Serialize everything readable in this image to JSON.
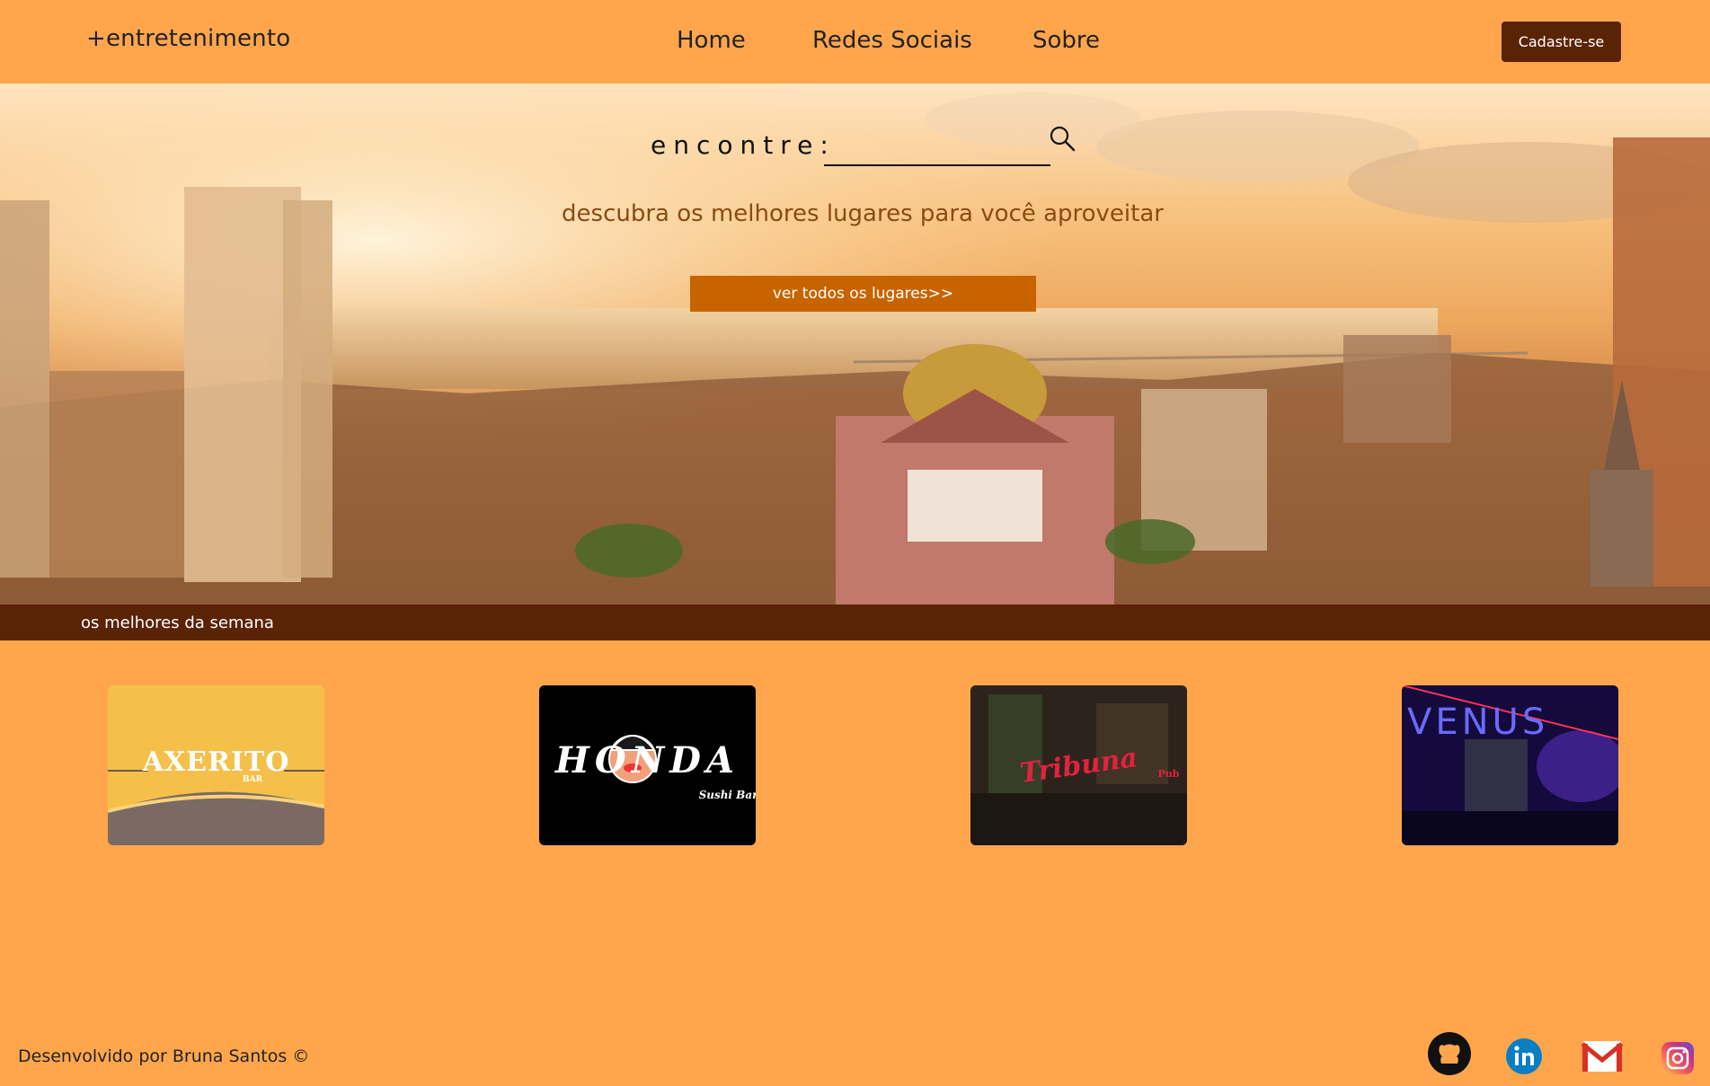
{
  "header": {
    "brand": "+entretenimento",
    "nav": [
      "Home",
      "Redes Sociais",
      "Sobre"
    ],
    "signup_label": "Cadastre-se"
  },
  "hero": {
    "search_label": "encontre:",
    "search_value": "",
    "tagline": "descubra os melhores lugares para você aproveitar",
    "see_all_label": "ver todos os lugares>>"
  },
  "section": {
    "title": "os melhores da semana"
  },
  "cards": [
    {
      "logo_text": "AXERITO",
      "sub": "BAR"
    },
    {
      "logo_text": "HONDA",
      "sub": "Sushi Bar"
    },
    {
      "logo_text": "Tribuna",
      "sub": "Pub"
    },
    {
      "logo_text": "VENUS",
      "sub": ""
    }
  ],
  "footer": {
    "credit": "Desenvolvido por Bruna Santos ©",
    "social_icons": [
      "github-icon",
      "linkedin-icon",
      "gmail-icon",
      "instagram-icon"
    ]
  },
  "colors": {
    "background": "#ffa64d",
    "dark_brown": "#5a2306",
    "button_orange": "#c76400"
  }
}
